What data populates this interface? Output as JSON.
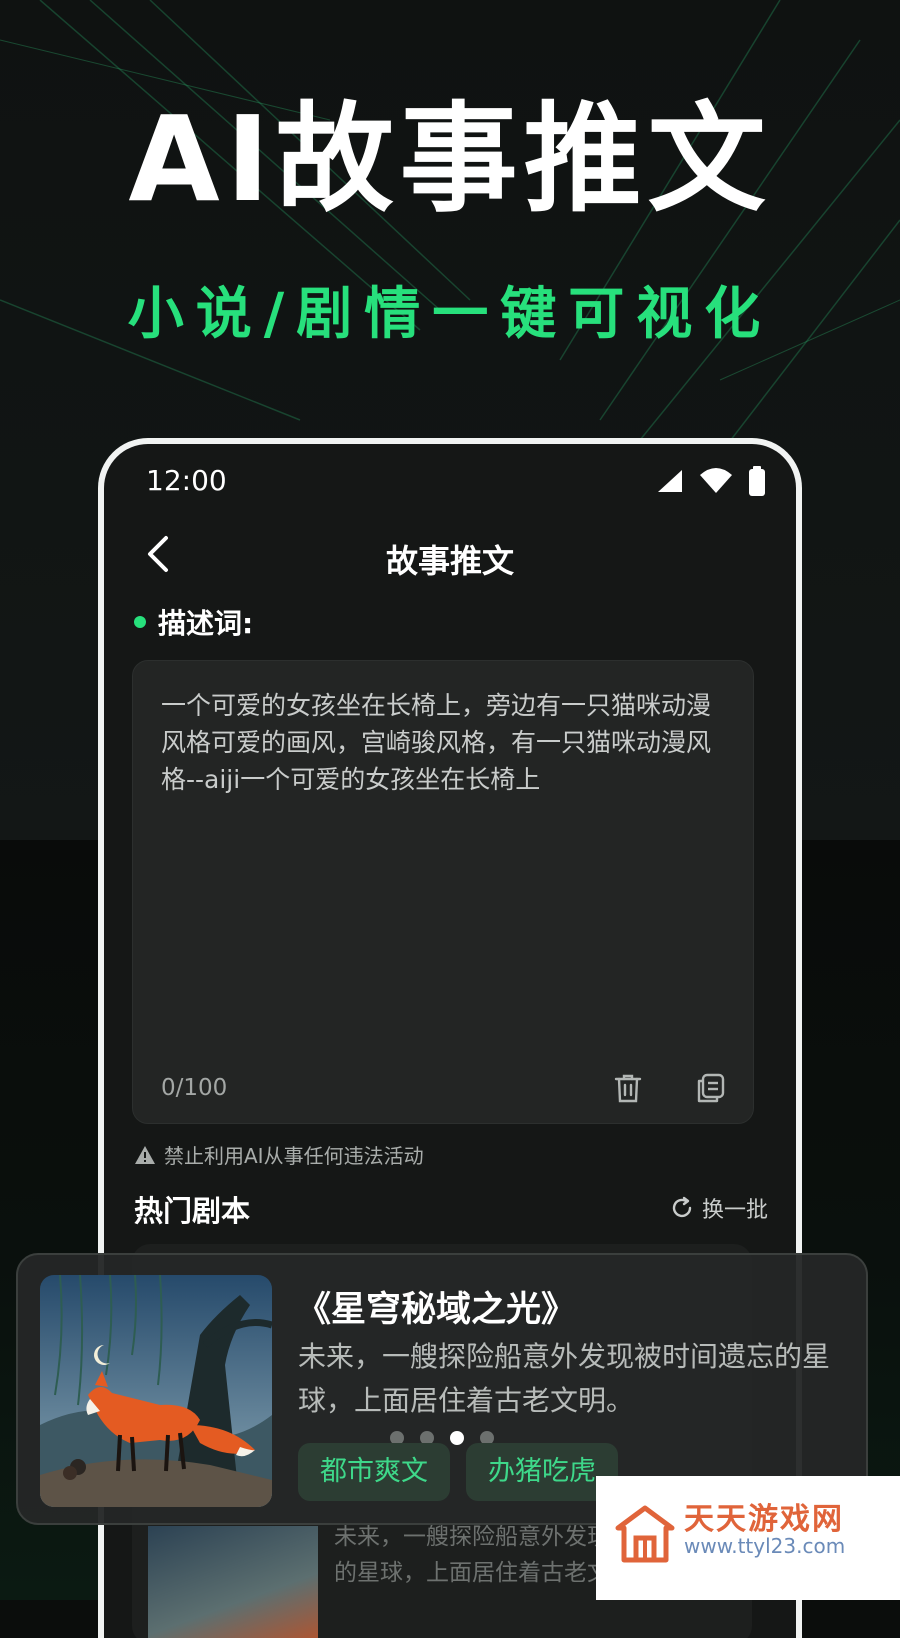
{
  "promo": {
    "headline": "AI故事推文",
    "subline": "小说/剧情一键可视化"
  },
  "status_bar": {
    "time": "12:00",
    "icons": [
      "signal-icon",
      "wifi-icon",
      "battery-icon"
    ]
  },
  "nav": {
    "back_icon": "chevron-left-icon",
    "title": "故事推文"
  },
  "prompt": {
    "label": "描述词:",
    "text": "一个可爱的女孩坐在长椅上，旁边有一只猫咪动漫风格可爱的画风，宫崎骏风格，有一只猫咪动漫风格--aiji一个可爱的女孩坐在长椅上",
    "counter": "0/100",
    "actions": [
      "trash-icon",
      "copy-icon"
    ]
  },
  "warning": {
    "icon": "warning-icon",
    "text": "禁止利用AI从事任何违法活动"
  },
  "hot_scripts": {
    "title": "热门剧本",
    "refresh_label": "换一批",
    "refresh_icon": "refresh-icon",
    "ghost_text": "未来，一艘探险船意外发现\n的星球，上面居住着古老文"
  },
  "featured_card": {
    "title": "《星穹秘域之光》",
    "description": "未来，一艘探险船意外发现被时间遗忘的星球，上面居住着古老文明。",
    "tags": [
      "都市爽文",
      "办猪吃虎"
    ],
    "page_count": 4,
    "active_page": 3,
    "image": "fox-illustration"
  },
  "watermark": {
    "name": "天天游戏网",
    "url": "www.ttyl23.com",
    "logo": "house-logo-icon"
  },
  "colors": {
    "accent_green": "#27e07c",
    "tag_text": "#3ed88a",
    "background": "#0b0d0c",
    "card_bg": "#242726"
  }
}
